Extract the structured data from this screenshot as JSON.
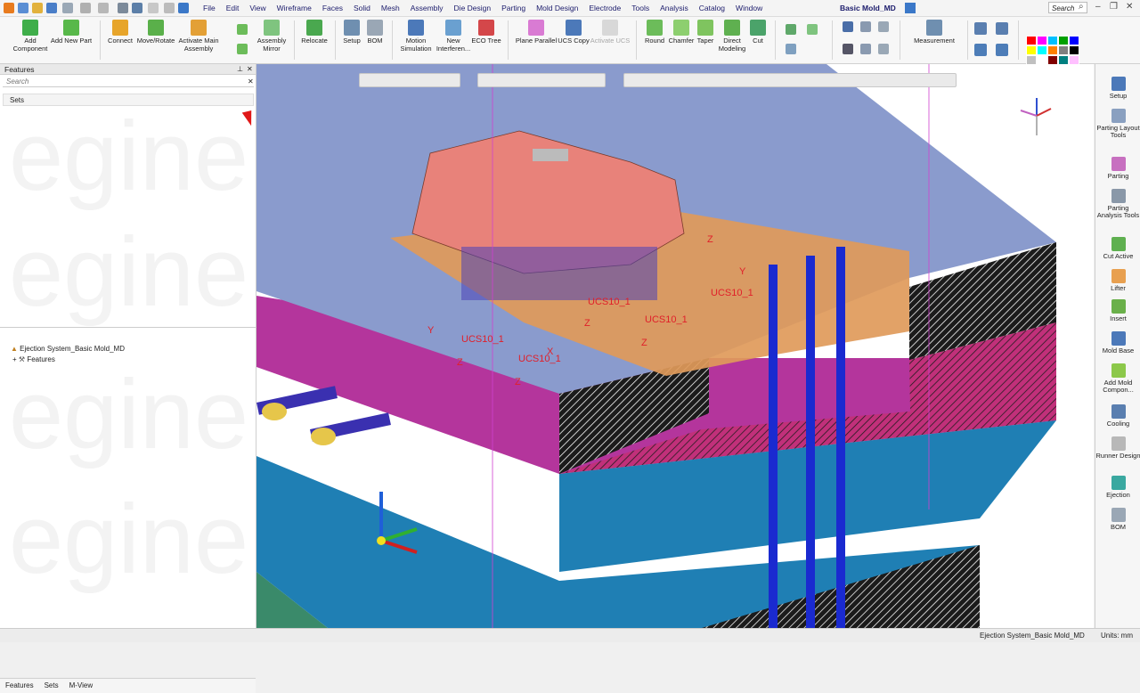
{
  "menu": [
    "File",
    "Edit",
    "View",
    "Wireframe",
    "Faces",
    "Solid",
    "Mesh",
    "Assembly",
    "Die Design",
    "Parting",
    "Mold Design",
    "Electrode",
    "Tools",
    "Analysis",
    "Catalog",
    "Window"
  ],
  "document_title": "Basic Mold_MD",
  "search_placeholder": "Search",
  "ribbon": {
    "add_component": "Add Component",
    "add_new_part": "Add New Part",
    "connect": "Connect",
    "move_rotate": "Move/Rotate",
    "activate_main_assembly": "Activate Main Assembly",
    "assembly_mirror": "Assembly Mirror",
    "relocate": "Relocate",
    "setup": "Setup",
    "bom": "BOM",
    "motion_simulation": "Motion Simulation",
    "new_interference": "New Interferen...",
    "eco_tree": "ECO Tree",
    "plane_parallel": "Plane Parallel",
    "ucs_copy": "UCS Copy",
    "activate_ucs": "Activate UCS",
    "round": "Round",
    "chamfer": "Chamfer",
    "taper": "Taper",
    "direct_modeling": "Direct Modeling",
    "cut": "Cut",
    "measurement": "Measurement"
  },
  "palette_colors": [
    "#ff0000",
    "#ff00ff",
    "#00c0ff",
    "#00a000",
    "#0000ff",
    "#ffff00",
    "#00ffff",
    "#ff8000",
    "#808080",
    "#000000",
    "#c0c0c0",
    "#ffffff",
    "#800000",
    "#008080",
    "#ffc0ff",
    "#e0e0e0",
    "#f0f0f0",
    "#d0d0d0",
    "#ffffff",
    "#ffffff"
  ],
  "left_panel": {
    "title": "Features",
    "search": "Search",
    "sets": "Sets",
    "tree_root": "Ejection System_Basic Mold_MD",
    "tree_child": "Features",
    "tabs": [
      "Features",
      "Sets",
      "M-View"
    ]
  },
  "viewport": {
    "ucs_label": "UCS10_1",
    "axis_x": "X",
    "axis_y": "Y",
    "axis_z": "Z"
  },
  "right_bar": [
    "Setup",
    "Parting Layout Tools",
    "Parting",
    "Parting Analysis Tools",
    "Cut Active",
    "Lifter",
    "Insert",
    "Mold Base",
    "Add Mold Compon...",
    "Cooling",
    "Runner Design",
    "Ejection",
    "BOM"
  ],
  "status": {
    "document": "Ejection System_Basic Mold_MD",
    "units": "Units: mm"
  }
}
